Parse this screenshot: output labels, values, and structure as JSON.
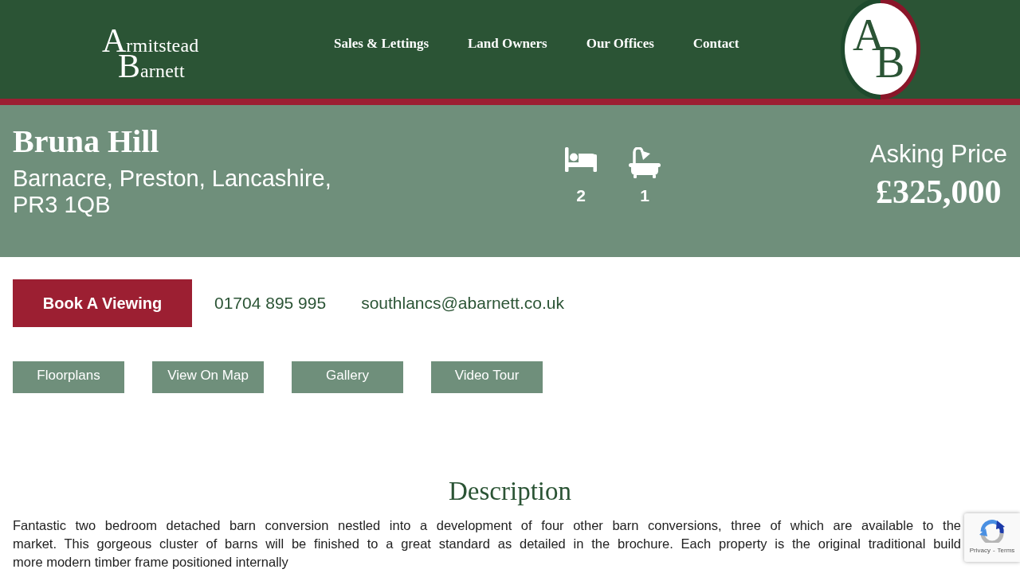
{
  "header": {
    "logo": {
      "lines": [
        "Armitstead",
        "Barnett"
      ]
    },
    "nav": [
      "Sales & Lettings",
      "Land Owners",
      "Our Offices",
      "Contact"
    ],
    "emblem": {
      "letters": [
        "A",
        "B"
      ]
    }
  },
  "property": {
    "title": "Bruna Hill",
    "address": "Barnacre, Preston, Lancashire, PR3 1QB",
    "features": [
      {
        "kind": "bedrooms",
        "count": "2"
      },
      {
        "kind": "bathrooms",
        "count": "1"
      }
    ],
    "price_label": "Asking Price",
    "price": "£325,000"
  },
  "contact": {
    "button": "Book A Viewing",
    "phone": "01704 895 995",
    "email": "southlancs@abarnett.co.uk"
  },
  "media_buttons": [
    "Floorplans",
    "View On Map",
    "Gallery",
    "Video Tour"
  ],
  "description": {
    "heading": "Description",
    "lines": [
      "Fantastic two bedroom detached barn conversion nestled into a development of four other barn conversions, three of which are available to the",
      "market. This gorgeous cluster of barns will be finished to a great standard as detailed in the brochure. Each property is the original traditional build",
      "more modern timber frame positioned internally"
    ]
  },
  "recaptcha": {
    "links": [
      "Privacy",
      "Terms"
    ],
    "separator": "-"
  }
}
